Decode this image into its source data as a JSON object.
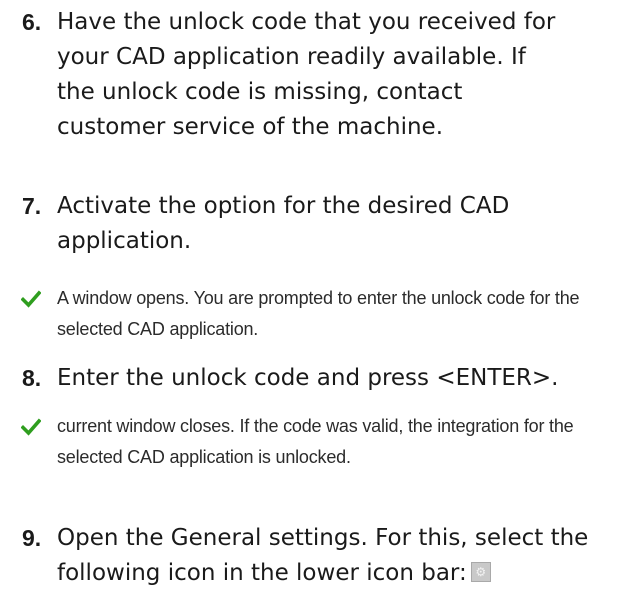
{
  "steps": [
    {
      "number": "6.",
      "text": "Have the unlock code that you received for your CAD application readily available. If the unlock code is missing, contact customer service of the machine."
    },
    {
      "number": "7.",
      "text": "Activate the option for the desired CAD application."
    },
    {
      "number": "8.",
      "text": "Enter the unlock code and press <ENTER>."
    },
    {
      "number": "9.",
      "text": "Open the General settings. For this, select the following icon in the lower icon bar:",
      "icon": "settings-gear-icon"
    }
  ],
  "results": [
    {
      "icon": "checkmark-icon",
      "text": "A window opens. You are prompted to enter the unlock code for the selected CAD application."
    },
    {
      "icon": "checkmark-icon",
      "text": "current window closes. If the code was valid, the integration for the selected CAD application is unlocked."
    }
  ],
  "colors": {
    "checkmark": "#2f9e1f",
    "text": "#1a1a1a",
    "icon_bg": "#c9c9c9"
  }
}
